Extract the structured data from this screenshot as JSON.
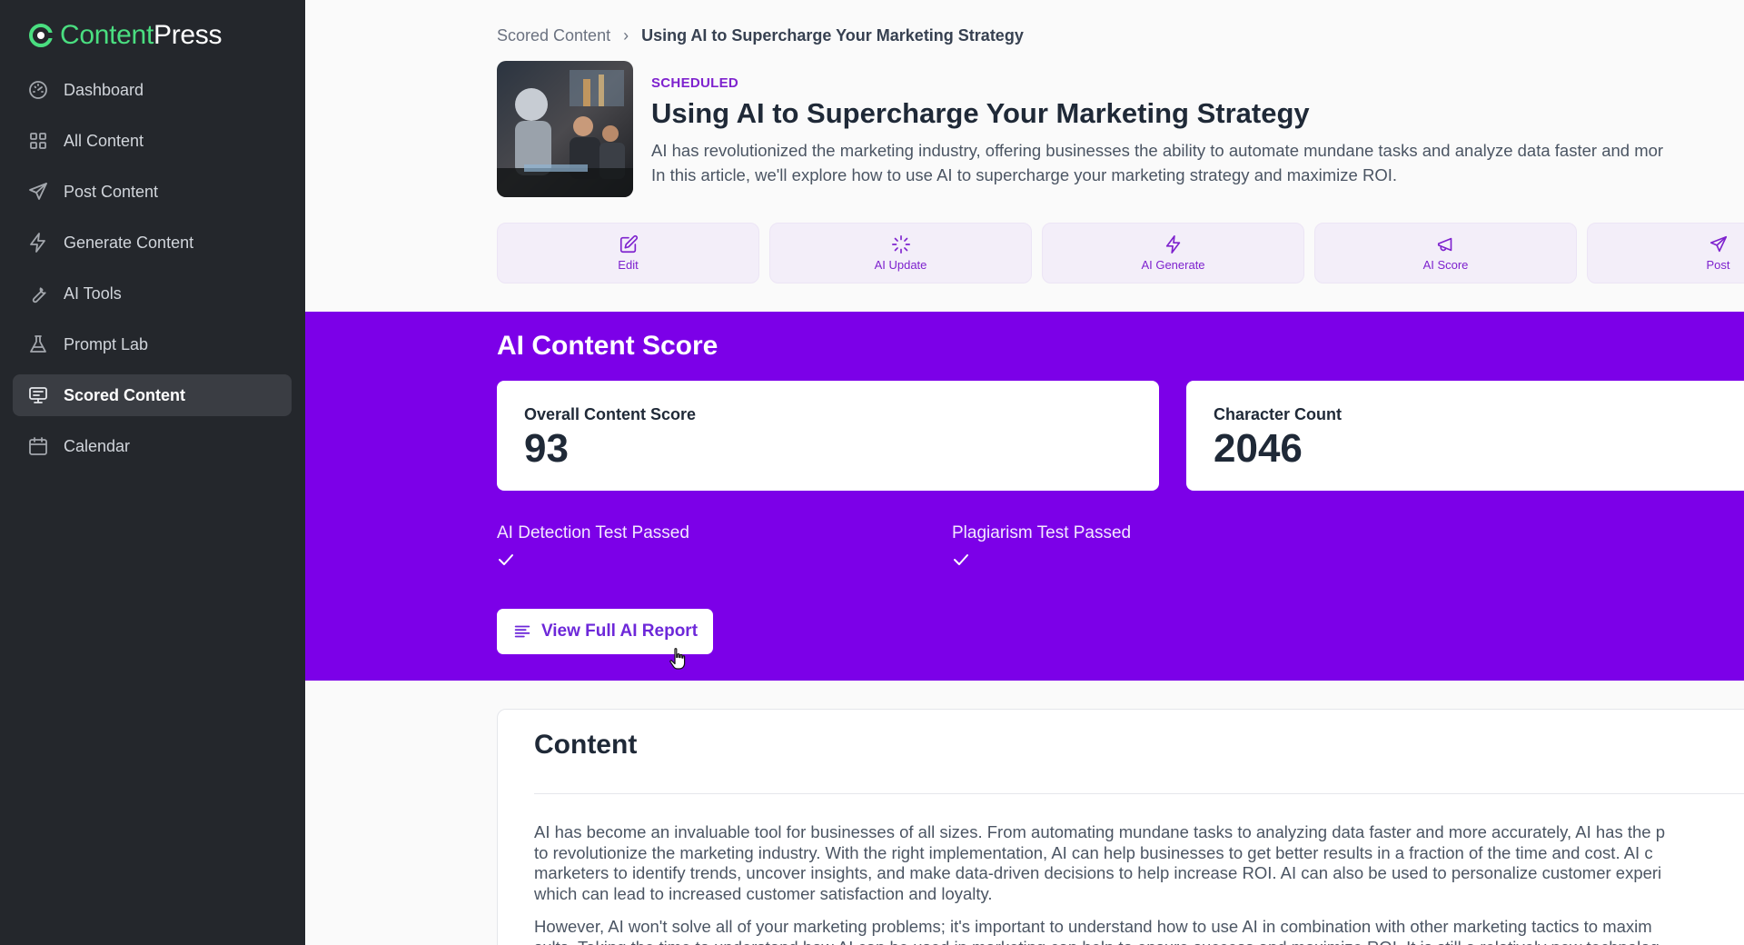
{
  "brand": {
    "name_part1": "Content",
    "name_part2": "Press"
  },
  "sidebar": {
    "items": [
      {
        "label": "Dashboard",
        "icon": "gauge-icon",
        "active": false
      },
      {
        "label": "All Content",
        "icon": "grid-icon",
        "active": false
      },
      {
        "label": "Post Content",
        "icon": "send-icon",
        "active": false
      },
      {
        "label": "Generate Content",
        "icon": "bolt-icon",
        "active": false
      },
      {
        "label": "AI Tools",
        "icon": "wrench-icon",
        "active": false
      },
      {
        "label": "Prompt Lab",
        "icon": "flask-icon",
        "active": false
      },
      {
        "label": "Scored Content",
        "icon": "scored-icon",
        "active": true
      },
      {
        "label": "Calendar",
        "icon": "calendar-icon",
        "active": false
      }
    ]
  },
  "breadcrumb": {
    "parent": "Scored Content",
    "separator": "›",
    "current": "Using AI to Supercharge Your Marketing Strategy"
  },
  "article": {
    "status": "SCHEDULED",
    "title": "Using AI to Supercharge Your Marketing Strategy",
    "description_line1": "AI has revolutionized the marketing industry, offering businesses the ability to automate mundane tasks and analyze data faster and mor",
    "description_line2": "In this article, we'll explore how to use AI to supercharge your marketing strategy and maximize ROI."
  },
  "actions": [
    {
      "label": "Edit",
      "icon": "edit-icon"
    },
    {
      "label": "AI Update",
      "icon": "sparkle-loader-icon"
    },
    {
      "label": "AI Generate",
      "icon": "bolt-icon"
    },
    {
      "label": "AI Score",
      "icon": "megaphone-icon"
    },
    {
      "label": "Post",
      "icon": "send-icon"
    }
  ],
  "score": {
    "section_title": "AI Content Score",
    "overall_label": "Overall Content Score",
    "overall_value": "93",
    "char_label": "Character Count",
    "char_value": "2046",
    "ai_detection": "AI Detection Test Passed",
    "plagiarism": "Plagiarism Test Passed",
    "report_button": "View Full AI Report"
  },
  "content": {
    "title": "Content",
    "para1_lines": [
      "AI has become an invaluable tool for businesses of all sizes. From automating mundane tasks to analyzing data faster and more accurately, AI has the p",
      "to revolutionize the marketing industry. With the right implementation, AI can help businesses to get better results in a fraction of the time and cost. AI c",
      "marketers to identify trends, uncover insights, and make data-driven decisions to help increase ROI. AI can also be used to personalize customer experi",
      "which can lead to increased customer satisfaction and loyalty."
    ],
    "para2_lines": [
      "However, AI won't solve all of your marketing problems; it's important to understand how to use AI in combination with other marketing tactics to maxim",
      "sults. Taking the time to understand how AI can be used in marketing can help to ensure success and maximize ROI. It is still a relatively new technolog"
    ]
  },
  "colors": {
    "accent": "#7c00e8",
    "sidebar_bg": "#24272c",
    "brand_green": "#4ade80"
  }
}
